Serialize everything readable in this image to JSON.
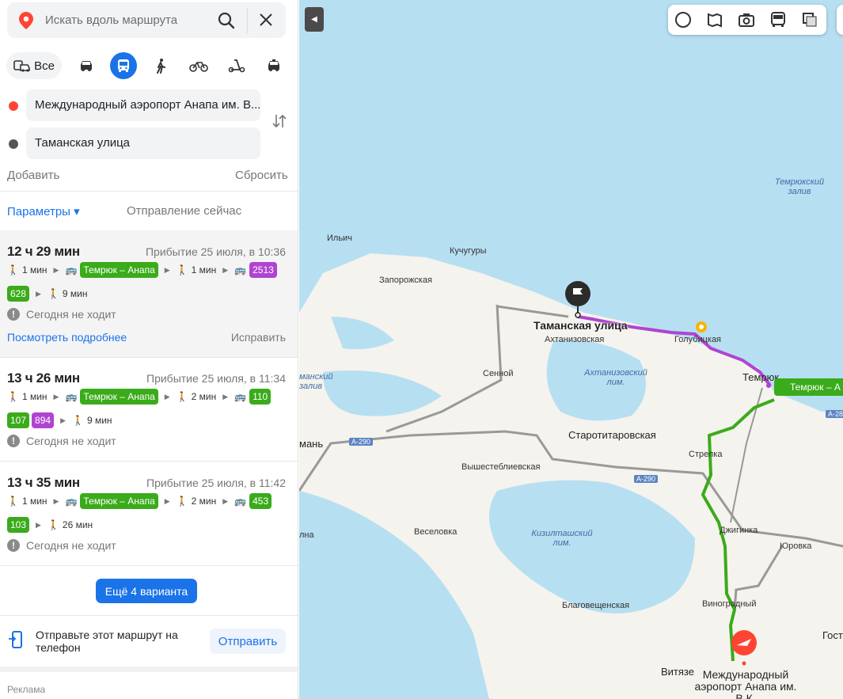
{
  "search": {
    "placeholder": "Искать вдоль маршрута"
  },
  "modes": {
    "all_label": "Все"
  },
  "points": {
    "from": "Международный аэропорт Анапа им. В...",
    "to": "Таманская улица",
    "add_label": "Добавить",
    "reset_label": "Сбросить"
  },
  "params": {
    "label": "Параметры ▾",
    "departure": "Отправление сейчас"
  },
  "routes": [
    {
      "duration": "12 ч 29 мин",
      "arrival": "Прибытие 25 июля, в 10:36",
      "walk1": "1 мин",
      "line1": "Темрюк – Анапа",
      "walk2": "1 мин",
      "bus_a": "2513",
      "bus_b": "628",
      "walk3": "9 мин",
      "status": "Сегодня не ходит",
      "details": "Посмотреть подробнее",
      "fix": "Исправить"
    },
    {
      "duration": "13 ч 26 мин",
      "arrival": "Прибытие 25 июля, в 11:34",
      "walk1": "1 мин",
      "line1": "Темрюк – Анапа",
      "walk2": "2 мин",
      "bus_a": "110",
      "bus_b": "107",
      "bus_c": "894",
      "walk3": "9 мин",
      "status": "Сегодня не ходит"
    },
    {
      "duration": "13 ч 35 мин",
      "arrival": "Прибытие 25 июля, в 11:42",
      "walk1": "1 мин",
      "line1": "Темрюк – Анапа",
      "walk2": "2 мин",
      "bus_a": "453",
      "bus_b": "103",
      "walk3": "26 мин",
      "status": "Сегодня не ходит"
    }
  ],
  "more_button": "Ещё 4 варианта",
  "send": {
    "text": "Отправьте этот маршрут на телефон",
    "button": "Отправить"
  },
  "ad_label": "Реклама",
  "map": {
    "labels": {
      "ilich": "Ильич",
      "kuchuguri": "Кучугуры",
      "zaporozhskaya": "Запорожская",
      "akhtanizovskaya": "Ахтанизовская",
      "golubitskaya": "Голубицкая",
      "temryuk": "Темрюк",
      "sennoy": "Сенной",
      "starotitarovskaya": "Старотитаровская",
      "vyshestebliyevskaya": "Вышестеблиевская",
      "strelka": "Стрелка",
      "dzhiginka": "Джигинка",
      "yurovka": "Юровка",
      "veselovka": "Веселовка",
      "blagoveshchenskaya": "Благовещенская",
      "vinogradny": "Виноградный",
      "vityazevo": "Витязе",
      "gost": "Гост",
      "taman": "мань",
      "anapa_cut": "лна",
      "temryuk_gulf": "Темрюкский залив",
      "akhtanizovsky_lake": "Ахтанизовский лим.",
      "kiziltash_lake": "Кизилташский лим.",
      "taman_gulf": "манский залив",
      "a290_1": "А-290",
      "a290_2": "А-290",
      "a28": "А-28"
    },
    "start_label": "Таманская улица",
    "end_label": "Международный аэропорт Анапа им. В.К.",
    "route_chip": "Темрюк – А",
    "colors": {
      "water": "#b7dff2",
      "land": "#f5f3ed",
      "bus_route": "#3aab1a",
      "tram_route": "#b044d1"
    }
  }
}
